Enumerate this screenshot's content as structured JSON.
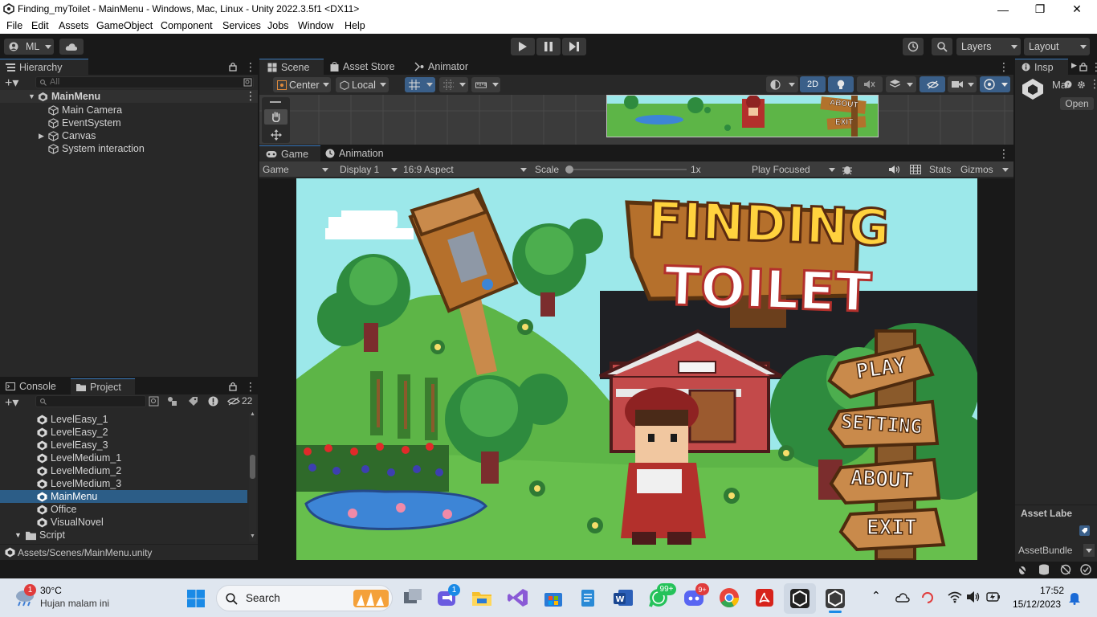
{
  "window": {
    "title": "Finding_myToilet - MainMenu - Windows, Mac, Linux - Unity 2022.3.5f1 <DX11>"
  },
  "menu": [
    "File",
    "Edit",
    "Assets",
    "GameObject",
    "Component",
    "Services",
    "Jobs",
    "Window",
    "Help"
  ],
  "toolbar": {
    "account": "ML",
    "layers": "Layers",
    "layout": "Layout"
  },
  "hierarchy": {
    "tab": "Hierarchy",
    "search_placeholder": "All",
    "scene": "MainMenu",
    "items": [
      "Main Camera",
      "EventSystem",
      "Canvas",
      "System interaction"
    ]
  },
  "scene_tabs": {
    "scene": "Scene",
    "asset_store": "Asset Store",
    "animator": "Animator",
    "pivot": "Center",
    "space": "Local",
    "mode_2d": "2D"
  },
  "game_tabs": {
    "game": "Game",
    "animation": "Animation",
    "game_dropdown": "Game",
    "display": "Display 1",
    "aspect": "16:9 Aspect",
    "scale_label": "Scale",
    "scale_value": "1x",
    "play_mode": "Play Focused",
    "stats": "Stats",
    "gizmos": "Gizmos"
  },
  "game_view": {
    "logo_line1": "FINDING",
    "logo_line2": "TOILET",
    "menu_buttons": [
      "PLAY",
      "SETTING",
      "ABOUT",
      "EXIT"
    ],
    "scene_thumb_labels": [
      "ABOUT",
      "EXIT"
    ]
  },
  "inspector": {
    "tab": "Insp",
    "object": "Ma",
    "open_button": "Open",
    "asset_labels": "Asset Labe",
    "asset_bundle": "AssetBundle"
  },
  "project": {
    "console_tab": "Console",
    "project_tab": "Project",
    "hidden_count": "22",
    "items": [
      "LevelEasy_1",
      "LevelEasy_2",
      "LevelEasy_3",
      "LevelMedium_1",
      "LevelMedium_2",
      "LevelMedium_3",
      "MainMenu",
      "Office",
      "VisualNovel"
    ],
    "folder": "Script",
    "selected": "MainMenu",
    "path": "Assets/Scenes/MainMenu.unity"
  },
  "taskbar": {
    "weather_temp": "30°C",
    "weather_desc": "Hujan malam ini",
    "weather_badge": "1",
    "search": "Search",
    "badges": {
      "meet": "1",
      "whatsapp": "99+",
      "discord": "9+"
    },
    "time": "17:52",
    "date": "15/12/2023"
  },
  "colors": {
    "editor_bg": "#282828",
    "selection": "#2c5d87",
    "accent_blue": "#3a79bb",
    "sky": "#9ce8ea",
    "grass": "#5db547"
  }
}
